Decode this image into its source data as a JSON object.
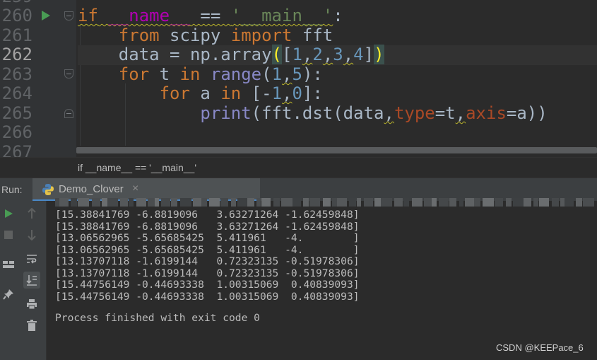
{
  "editor": {
    "line_numbers": [
      "260",
      "261",
      "262",
      "263",
      "264",
      "265",
      "266",
      "267"
    ],
    "current_line": "262"
  },
  "breadcrumb": {
    "text": "if __name__ == '__main__'"
  },
  "run_window": {
    "label": "Run:",
    "tab": {
      "title": "Demo_Clover",
      "close_glyph": "×"
    }
  },
  "console": {
    "lines": [
      "[15.38841769 -6.8819096   3.63271264 -1.62459848]",
      "[15.38841769 -6.8819096   3.63271264 -1.62459848]",
      "[13.06562965 -5.65685425  5.411961   -4.        ]",
      "[13.06562965 -5.65685425  5.411961   -4.        ]",
      "[13.13707118 -1.6199144   0.72323135 -0.51978306]",
      "[13.13707118 -1.6199144   0.72323135 -0.51978306]",
      "[15.44756149 -0.44693338  1.00315069  0.40839093]",
      "[15.44756149 -0.44693338  1.00315069  0.40839093]"
    ],
    "finish_message": "Process finished with exit code 0"
  },
  "watermark": "CSDN @KEEPace_6",
  "colors": {
    "editor_bg": "#2b2b2b",
    "gutter_bg": "#313335",
    "keyword": "#cc7832",
    "string": "#6a8759",
    "number": "#6897bb",
    "dunder": "#b200b2",
    "builtin": "#8888c6",
    "run_green": "#499c54"
  },
  "icons": [
    "run-gutter-icon",
    "python-file-icon",
    "rerun-icon",
    "stop-icon",
    "layout-icon",
    "pin-icon",
    "scroll-up-icon",
    "scroll-down-icon",
    "soft-wrap-icon",
    "scroll-to-end-icon",
    "print-icon",
    "trash-icon"
  ]
}
